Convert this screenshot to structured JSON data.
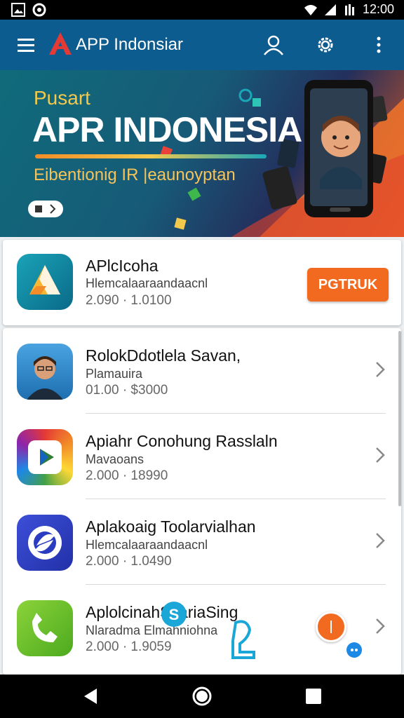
{
  "status_bar": {
    "time": "12:00"
  },
  "app_bar": {
    "title": "APP Indonsiar"
  },
  "banner": {
    "kicker": "Pusart",
    "headline": "APR INDONESIA",
    "subtitle": "Eibentionig IR |eaunoyptan"
  },
  "featured": {
    "name": "APlcIcoha",
    "developer": "Hlemcalaaraandaacnl",
    "stats": "2.090 · 1.0100",
    "install_label": "PGTRUK"
  },
  "apps": [
    {
      "name": "RolokDdotlela Savan,",
      "developer": "Plamauira",
      "stats": "01.00 · $3000"
    },
    {
      "name": "Apiahr Conohung Rasslaln",
      "developer": "Mavaoans",
      "stats": "2.000 · 18990"
    },
    {
      "name": "Aplakoaig Toolarvialhan",
      "developer": "Hlemcalaaraandaacnl",
      "stats": "2.000 · 1.0490"
    },
    {
      "name": "AplolcinahSkariaSing",
      "developer": "Nlaradma Elmahniohna",
      "stats": "2.000 · 1.9059"
    }
  ],
  "colors": {
    "app_bar": "#0d5c8f",
    "install_button": "#f26a1f",
    "banner_accent": "#f2c94c"
  }
}
